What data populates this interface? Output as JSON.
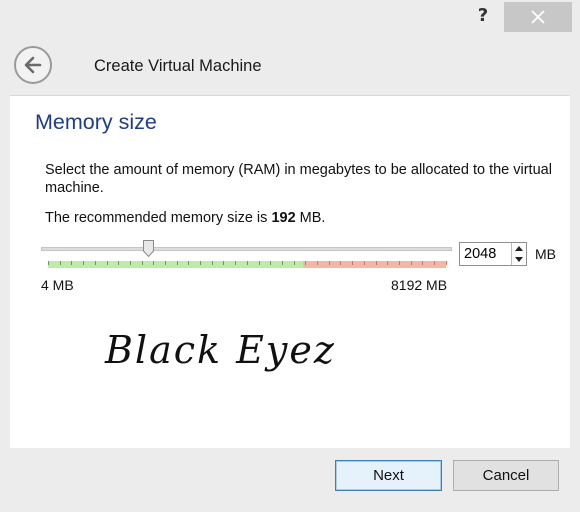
{
  "window": {
    "help_label": "?",
    "close_icon": "close-icon"
  },
  "header": {
    "back_icon": "back-arrow-icon",
    "title": "Create Virtual Machine"
  },
  "page": {
    "heading": "Memory size",
    "description": "Select the amount of memory (RAM) in megabytes to be allocated to the virtual machine.",
    "recommend_prefix": "The recommended memory size is ",
    "recommend_value": "192",
    "recommend_suffix": " MB."
  },
  "memory": {
    "value": "2048",
    "unit": "MB",
    "min_label": "4 MB",
    "max_label": "8192 MB",
    "slider_fraction": 0.25,
    "safe_fraction": 0.64,
    "safe_color": "#bfeaa8",
    "warn_color": "#f5b6a8"
  },
  "watermark": "Black Eyez",
  "footer": {
    "next_label": "Next",
    "cancel_label": "Cancel"
  },
  "colors": {
    "heading": "#1f3c88",
    "close_button_bg": "#c7c7c7",
    "next_button_border": "#3c7fb1"
  }
}
